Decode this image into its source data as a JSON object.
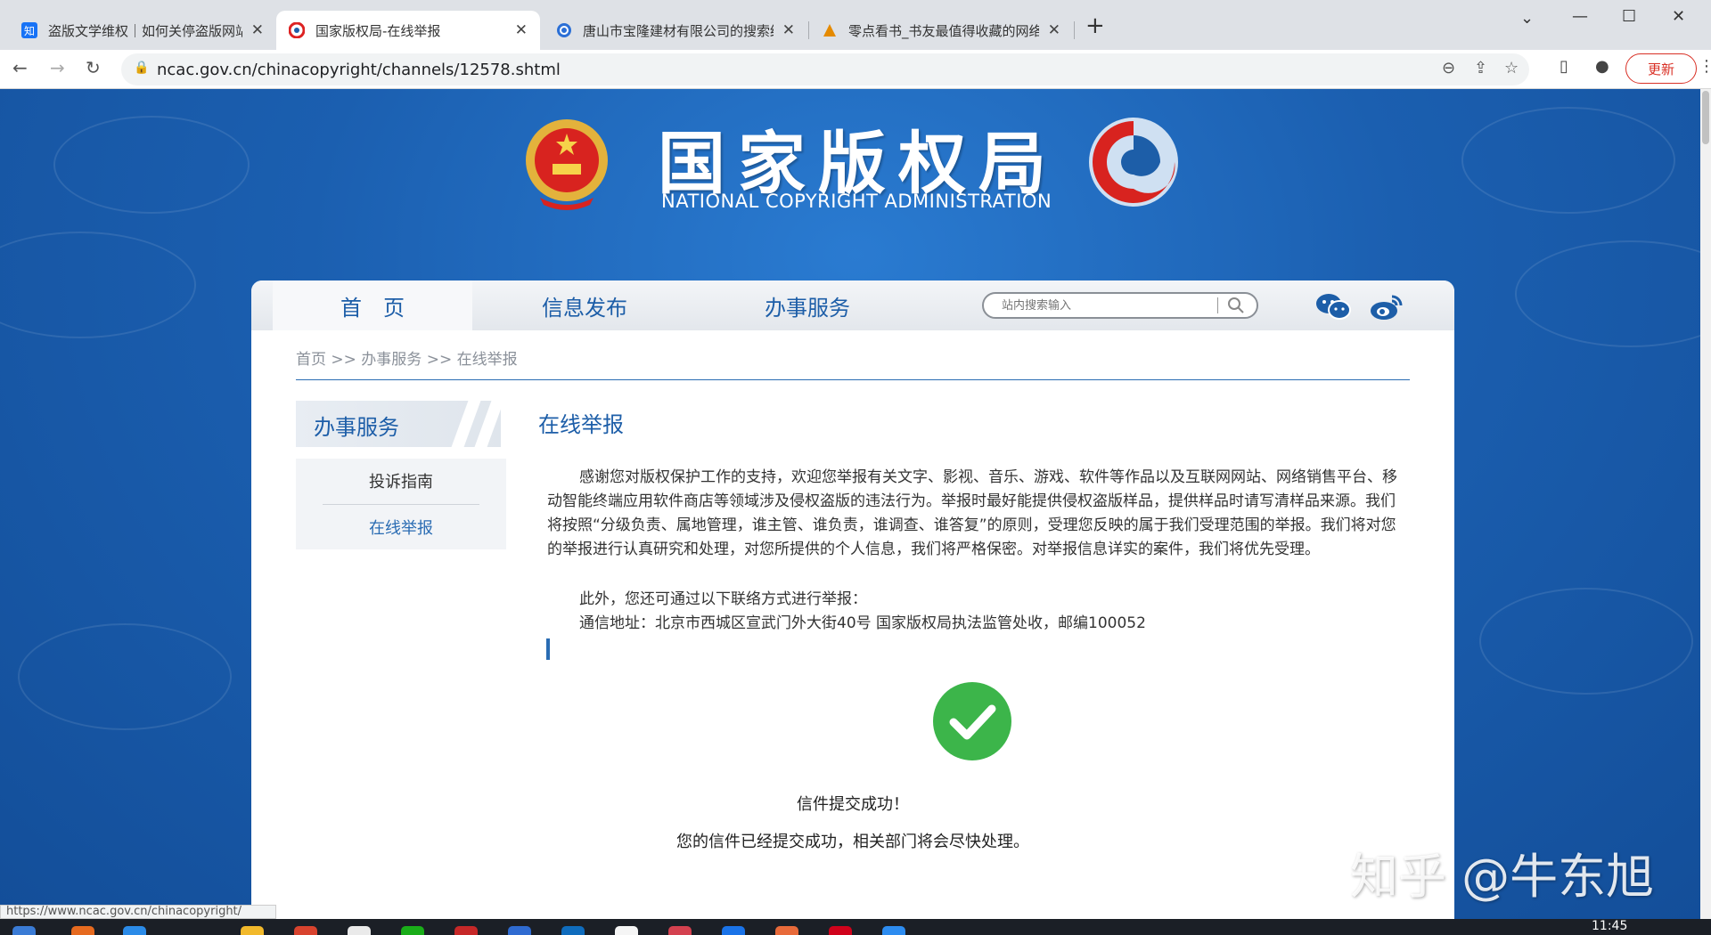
{
  "browser": {
    "tabs": [
      {
        "title": "盗版文学维权｜如何关停盗版网站",
        "favicon_text": "知",
        "favicon_color": "#1772f6"
      },
      {
        "title": "国家版权局-在线举报",
        "favicon_text": "",
        "favicon_color": "#d22"
      },
      {
        "title": "唐山市宝隆建材有限公司的搜索结果",
        "favicon_text": "",
        "favicon_color": "#2b6fd6"
      },
      {
        "title": "零点看书_书友最值得收藏的网络小说",
        "favicon_text": "",
        "favicon_color": "#e58a00"
      }
    ],
    "url": "ncac.gov.cn/chinacopyright/channels/12578.shtml",
    "update_label": "更新",
    "status_url": "https://www.ncac.gov.cn/chinacopyright/"
  },
  "header": {
    "title": "国家版权局",
    "subtitle": "NATIONAL COPYRIGHT ADMINISTRATION"
  },
  "nav": {
    "items": [
      "首　页",
      "信息发布",
      "办事服务"
    ],
    "search_placeholder": "站内搜索输入"
  },
  "breadcrumb": "首页 >> 办事服务 >> 在线举报",
  "sidebar": {
    "heading": "办事服务",
    "items": [
      "投诉指南",
      "在线举报"
    ]
  },
  "content": {
    "title": "在线举报",
    "paragraph": "感谢您对版权保护工作的支持，欢迎您举报有关文字、影视、音乐、游戏、软件等作品以及互联网网站、网络销售平台、移动智能终端应用软件商店等领域涉及侵权盗版的违法行为。举报时最好能提供侵权盗版样品，提供样品时请写清样品来源。我们将按照“分级负责、属地管理，谁主管、谁负责，谁调查、谁答复”的原则，受理您反映的属于我们受理范围的举报。我们将对您的举报进行认真研究和处理，对您所提供的个人信息，我们将严格保密。对举报信息详实的案件，我们将优先受理。",
    "line2": "此外，您还可通过以下联络方式进行举报：",
    "line3": "通信地址：北京市西城区宣武门外大街40号 国家版权局执法监管处收，邮编100052"
  },
  "success": {
    "title": "信件提交成功！",
    "message": "您的信件已经提交成功，相关部门将会尽快处理。"
  },
  "watermark": "知乎 @牛东旭",
  "taskbar": {
    "clock": "11:45"
  },
  "colors": {
    "brand_blue": "#1d5ea8",
    "page_bg": "#1b5fb0",
    "success_green": "#3cb54a",
    "update_red": "#d93025"
  }
}
